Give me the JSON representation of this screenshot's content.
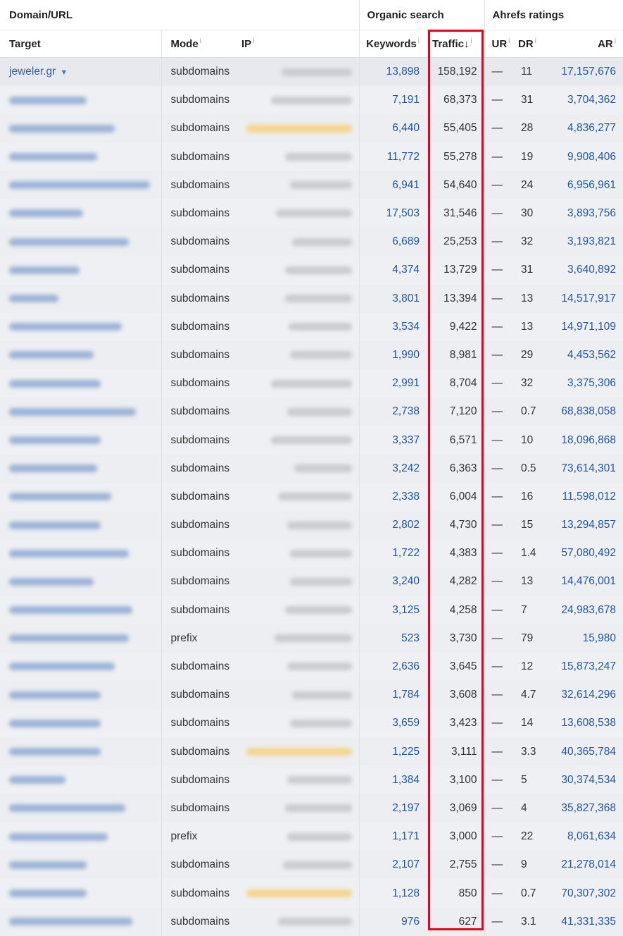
{
  "groups": {
    "domain": "Domain/URL",
    "organic": "Organic search",
    "ahrefs": "Ahrefs ratings"
  },
  "columns": {
    "target": "Target",
    "mode": "Mode",
    "ip": "IP",
    "keywords": "Keywords",
    "traffic": "Traffic",
    "ur": "UR",
    "dr": "DR",
    "ar": "AR",
    "info_mark": "i",
    "sort_arrow": "↓"
  },
  "rows": [
    {
      "target": "jeweler.gr",
      "mode": "subdomains",
      "keywords": "13,898",
      "traffic": "158,192",
      "ur": "—",
      "dr": "11",
      "ar": "17,157,676"
    },
    {
      "target": "",
      "mode": "subdomains",
      "keywords": "7,191",
      "traffic": "68,373",
      "ur": "—",
      "dr": "31",
      "ar": "3,704,362"
    },
    {
      "target": "",
      "mode": "subdomains",
      "keywords": "6,440",
      "traffic": "55,405",
      "ur": "—",
      "dr": "28",
      "ar": "4,836,277"
    },
    {
      "target": "",
      "mode": "subdomains",
      "keywords": "11,772",
      "traffic": "55,278",
      "ur": "—",
      "dr": "19",
      "ar": "9,908,406"
    },
    {
      "target": "",
      "mode": "subdomains",
      "keywords": "6,941",
      "traffic": "54,640",
      "ur": "—",
      "dr": "24",
      "ar": "6,956,961"
    },
    {
      "target": "",
      "mode": "subdomains",
      "keywords": "17,503",
      "traffic": "31,546",
      "ur": "—",
      "dr": "30",
      "ar": "3,893,756"
    },
    {
      "target": "",
      "mode": "subdomains",
      "keywords": "6,689",
      "traffic": "25,253",
      "ur": "—",
      "dr": "32",
      "ar": "3,193,821"
    },
    {
      "target": "",
      "mode": "subdomains",
      "keywords": "4,374",
      "traffic": "13,729",
      "ur": "—",
      "dr": "31",
      "ar": "3,640,892"
    },
    {
      "target": "",
      "mode": "subdomains",
      "keywords": "3,801",
      "traffic": "13,394",
      "ur": "—",
      "dr": "13",
      "ar": "14,517,917"
    },
    {
      "target": "",
      "mode": "subdomains",
      "keywords": "3,534",
      "traffic": "9,422",
      "ur": "—",
      "dr": "13",
      "ar": "14,971,109"
    },
    {
      "target": "",
      "mode": "subdomains",
      "keywords": "1,990",
      "traffic": "8,981",
      "ur": "—",
      "dr": "29",
      "ar": "4,453,562"
    },
    {
      "target": "",
      "mode": "subdomains",
      "keywords": "2,991",
      "traffic": "8,704",
      "ur": "—",
      "dr": "32",
      "ar": "3,375,306"
    },
    {
      "target": "",
      "mode": "subdomains",
      "keywords": "2,738",
      "traffic": "7,120",
      "ur": "—",
      "dr": "0.7",
      "ar": "68,838,058"
    },
    {
      "target": "",
      "mode": "subdomains",
      "keywords": "3,337",
      "traffic": "6,571",
      "ur": "—",
      "dr": "10",
      "ar": "18,096,868"
    },
    {
      "target": "",
      "mode": "subdomains",
      "keywords": "3,242",
      "traffic": "6,363",
      "ur": "—",
      "dr": "0.5",
      "ar": "73,614,301"
    },
    {
      "target": "",
      "mode": "subdomains",
      "keywords": "2,338",
      "traffic": "6,004",
      "ur": "—",
      "dr": "16",
      "ar": "11,598,012"
    },
    {
      "target": "",
      "mode": "subdomains",
      "keywords": "2,802",
      "traffic": "4,730",
      "ur": "—",
      "dr": "15",
      "ar": "13,294,857"
    },
    {
      "target": "",
      "mode": "subdomains",
      "keywords": "1,722",
      "traffic": "4,383",
      "ur": "—",
      "dr": "1.4",
      "ar": "57,080,492"
    },
    {
      "target": "",
      "mode": "subdomains",
      "keywords": "3,240",
      "traffic": "4,282",
      "ur": "—",
      "dr": "13",
      "ar": "14,476,001"
    },
    {
      "target": "",
      "mode": "subdomains",
      "keywords": "3,125",
      "traffic": "4,258",
      "ur": "—",
      "dr": "7",
      "ar": "24,983,678"
    },
    {
      "target": "",
      "mode": "prefix",
      "keywords": "523",
      "traffic": "3,730",
      "ur": "—",
      "dr": "79",
      "ar": "15,980"
    },
    {
      "target": "",
      "mode": "subdomains",
      "keywords": "2,636",
      "traffic": "3,645",
      "ur": "—",
      "dr": "12",
      "ar": "15,873,247"
    },
    {
      "target": "",
      "mode": "subdomains",
      "keywords": "1,784",
      "traffic": "3,608",
      "ur": "—",
      "dr": "4.7",
      "ar": "32,614,296"
    },
    {
      "target": "",
      "mode": "subdomains",
      "keywords": "3,659",
      "traffic": "3,423",
      "ur": "—",
      "dr": "14",
      "ar": "13,608,538"
    },
    {
      "target": "",
      "mode": "subdomains",
      "keywords": "1,225",
      "traffic": "3,111",
      "ur": "—",
      "dr": "3.3",
      "ar": "40,365,784"
    },
    {
      "target": "",
      "mode": "subdomains",
      "keywords": "1,384",
      "traffic": "3,100",
      "ur": "—",
      "dr": "5",
      "ar": "30,374,534"
    },
    {
      "target": "",
      "mode": "subdomains",
      "keywords": "2,197",
      "traffic": "3,069",
      "ur": "—",
      "dr": "4",
      "ar": "35,827,368"
    },
    {
      "target": "",
      "mode": "prefix",
      "keywords": "1,171",
      "traffic": "3,000",
      "ur": "—",
      "dr": "22",
      "ar": "8,061,634"
    },
    {
      "target": "",
      "mode": "subdomains",
      "keywords": "2,107",
      "traffic": "2,755",
      "ur": "—",
      "dr": "9",
      "ar": "21,278,014"
    },
    {
      "target": "",
      "mode": "subdomains",
      "keywords": "1,128",
      "traffic": "850",
      "ur": "—",
      "dr": "0.7",
      "ar": "70,307,302"
    },
    {
      "target": "",
      "mode": "subdomains",
      "keywords": "976",
      "traffic": "627",
      "ur": "—",
      "dr": "3.1",
      "ar": "41,331,335"
    }
  ],
  "highlight_color": "#e8001d"
}
